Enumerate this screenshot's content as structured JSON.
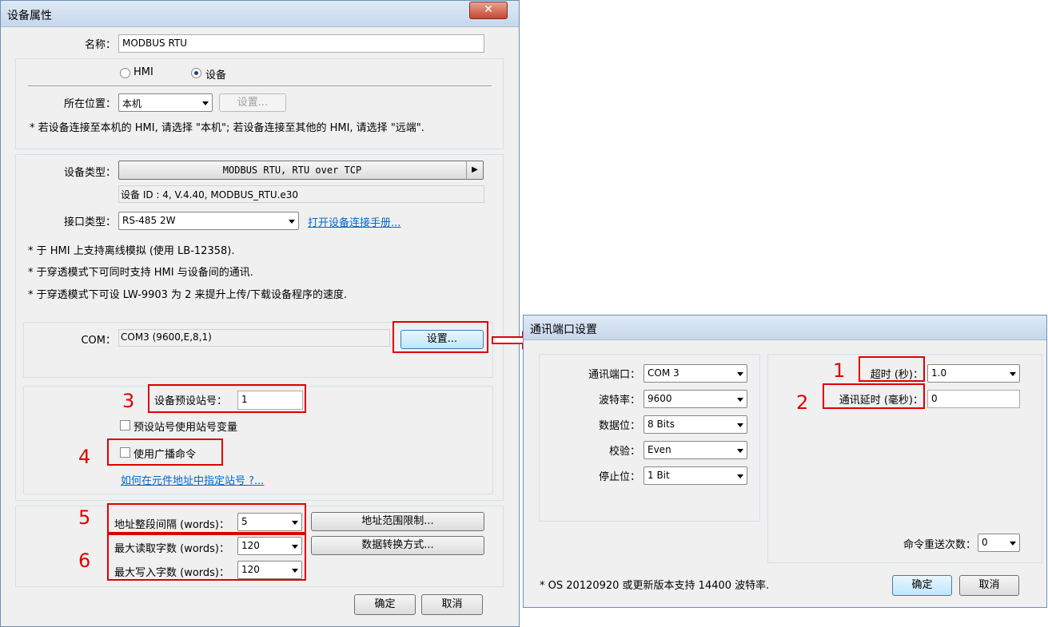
{
  "left_dialog": {
    "title": "设备属性",
    "close_glyph": "✕",
    "name_label": "名称：",
    "name_value": "MODBUS RTU",
    "radio_hmi": "HMI",
    "radio_device": "设备",
    "location_label": "所在位置：",
    "location_value": "本机",
    "location_settings": "设置...",
    "location_note": "* 若设备连接至本机的 HMI, 请选择 \"本机\"; 若设备连接至其他的 HMI, 请选择 \"远端\".",
    "device_type_label": "设备类型：",
    "device_type_value": "MODBUS RTU, RTU over TCP",
    "device_type_arrow": "▶",
    "device_id": "设备 ID : 4, V.4.40, MODBUS_RTU.e30",
    "interface_label": "接口类型：",
    "interface_value": "RS-485 2W",
    "manual_link": "打开设备连接手册...",
    "notes": [
      "* 于 HMI 上支持离线模拟 (使用 LB-12358).",
      "* 于穿透模式下可同时支持 HMI 与设备间的通讯.",
      "* 于穿透模式下可设 LW-9903 为 2 来提升上传/下载设备程序的速度."
    ],
    "com_label": "COM：",
    "com_value": "COM3 (9600,E,8,1)",
    "com_settings": "设置...",
    "station_label": "设备预设站号：",
    "station_value": "1",
    "station_var_label": "预设站号使用站号变量",
    "broadcast_label": "使用广播命令",
    "station_link": "如何在元件地址中指定站号 ?...",
    "addr_gap_label": "地址整段间隔 (words)：",
    "addr_gap_value": "5",
    "addr_range_btn": "地址范围限制...",
    "max_read_label": "最大读取字数 (words)：",
    "max_read_value": "120",
    "data_conv_btn": "数据转换方式...",
    "max_write_label": "最大写入字数 (words)：",
    "max_write_value": "120",
    "ok": "确定",
    "cancel": "取消"
  },
  "right_dialog": {
    "title": "通讯端口设置",
    "port_label": "通讯端口：",
    "port_value": "COM 3",
    "baud_label": "波特率：",
    "baud_value": "9600",
    "databits_label": "数据位：",
    "databits_value": "8 Bits",
    "parity_label": "校验：",
    "parity_value": "Even",
    "stopbits_label": "停止位：",
    "stopbits_value": "1 Bit",
    "timeout_label": "超时 (秒)：",
    "timeout_value": "1.0",
    "delay_label": "通讯延时 (毫秒)：",
    "delay_value": "0",
    "retry_label": "命令重送次数：",
    "retry_value": "0",
    "note": "* OS 20120920 或更新版本支持 14400 波特率.",
    "ok": "确定",
    "cancel": "取消"
  },
  "annotations": [
    "1",
    "2",
    "3",
    "4",
    "5",
    "6"
  ],
  "colors": {
    "highlight": "#e00000",
    "link": "#0066cc",
    "titlebar": "#c6d7ec"
  }
}
